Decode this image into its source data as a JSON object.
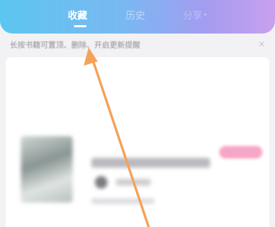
{
  "tabs": [
    {
      "label": "收藏",
      "active": true
    },
    {
      "label": "历史",
      "active": false
    },
    {
      "label": "分享",
      "active": false
    }
  ],
  "hint": {
    "text": "长按书籍可置顶、删除、开启更新提醒",
    "close_icon": "close-icon"
  },
  "colors": {
    "header_start": "#5cc6f0",
    "header_end": "#c9a0ee",
    "arrow": "#f4a259",
    "badge": "#f6a6c6"
  }
}
